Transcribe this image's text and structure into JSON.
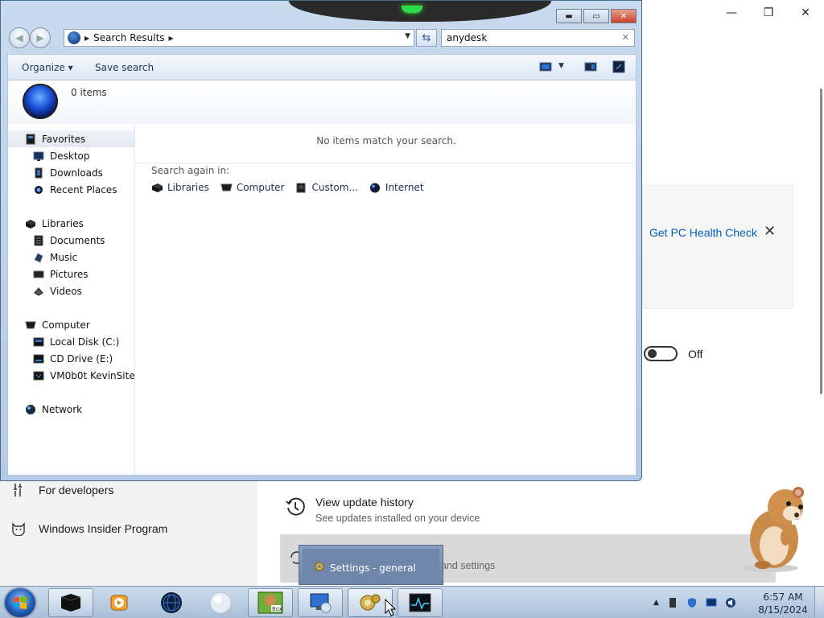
{
  "settings": {
    "caption_buttons": [
      "minimize",
      "restore",
      "close"
    ],
    "nav_items": [
      {
        "label": "For developers",
        "icon": "tools-icon"
      },
      {
        "label": "Windows Insider Program",
        "icon": "insider-cat-icon"
      }
    ],
    "health_card": {
      "link": "Get PC Health Check",
      "close_glyph": "✕"
    },
    "toggle": {
      "state": "Off"
    },
    "update_history": {
      "title": "View update history",
      "subtitle": "See updates installed on your device"
    },
    "advanced_options_partial": "and settings"
  },
  "explorer": {
    "address": {
      "location": "Search Results"
    },
    "search": {
      "query": "anydesk",
      "clear_glyph": "✕"
    },
    "toolbar": {
      "organize": "Organize",
      "save_search": "Save search"
    },
    "details": {
      "item_count": "0 items"
    },
    "nav": {
      "favorites": {
        "label": "Favorites",
        "items": [
          "Desktop",
          "Downloads",
          "Recent Places"
        ]
      },
      "libraries": {
        "label": "Libraries",
        "items": [
          "Documents",
          "Music",
          "Pictures",
          "Videos"
        ]
      },
      "computer": {
        "label": "Computer",
        "items": [
          "Local Disk (C:)",
          "CD Drive (E:)",
          "VM0b0t KevinSite"
        ]
      },
      "network": {
        "label": "Network"
      }
    },
    "results": {
      "empty_message": "No items match your search.",
      "search_again_label": "Search again in:",
      "search_again_items": [
        "Libraries",
        "Computer",
        "Custom...",
        "Internet"
      ]
    }
  },
  "taskbar": {
    "apps": [
      "command-prompt",
      "media-player",
      "globe-browser",
      "white-orb",
      "game-box",
      "remote-desktop",
      "settings",
      "task-monitor"
    ],
    "thumbnail_tooltip": "Settings - general",
    "clock": {
      "time": "6:57 AM",
      "date": "8/15/2024"
    }
  }
}
